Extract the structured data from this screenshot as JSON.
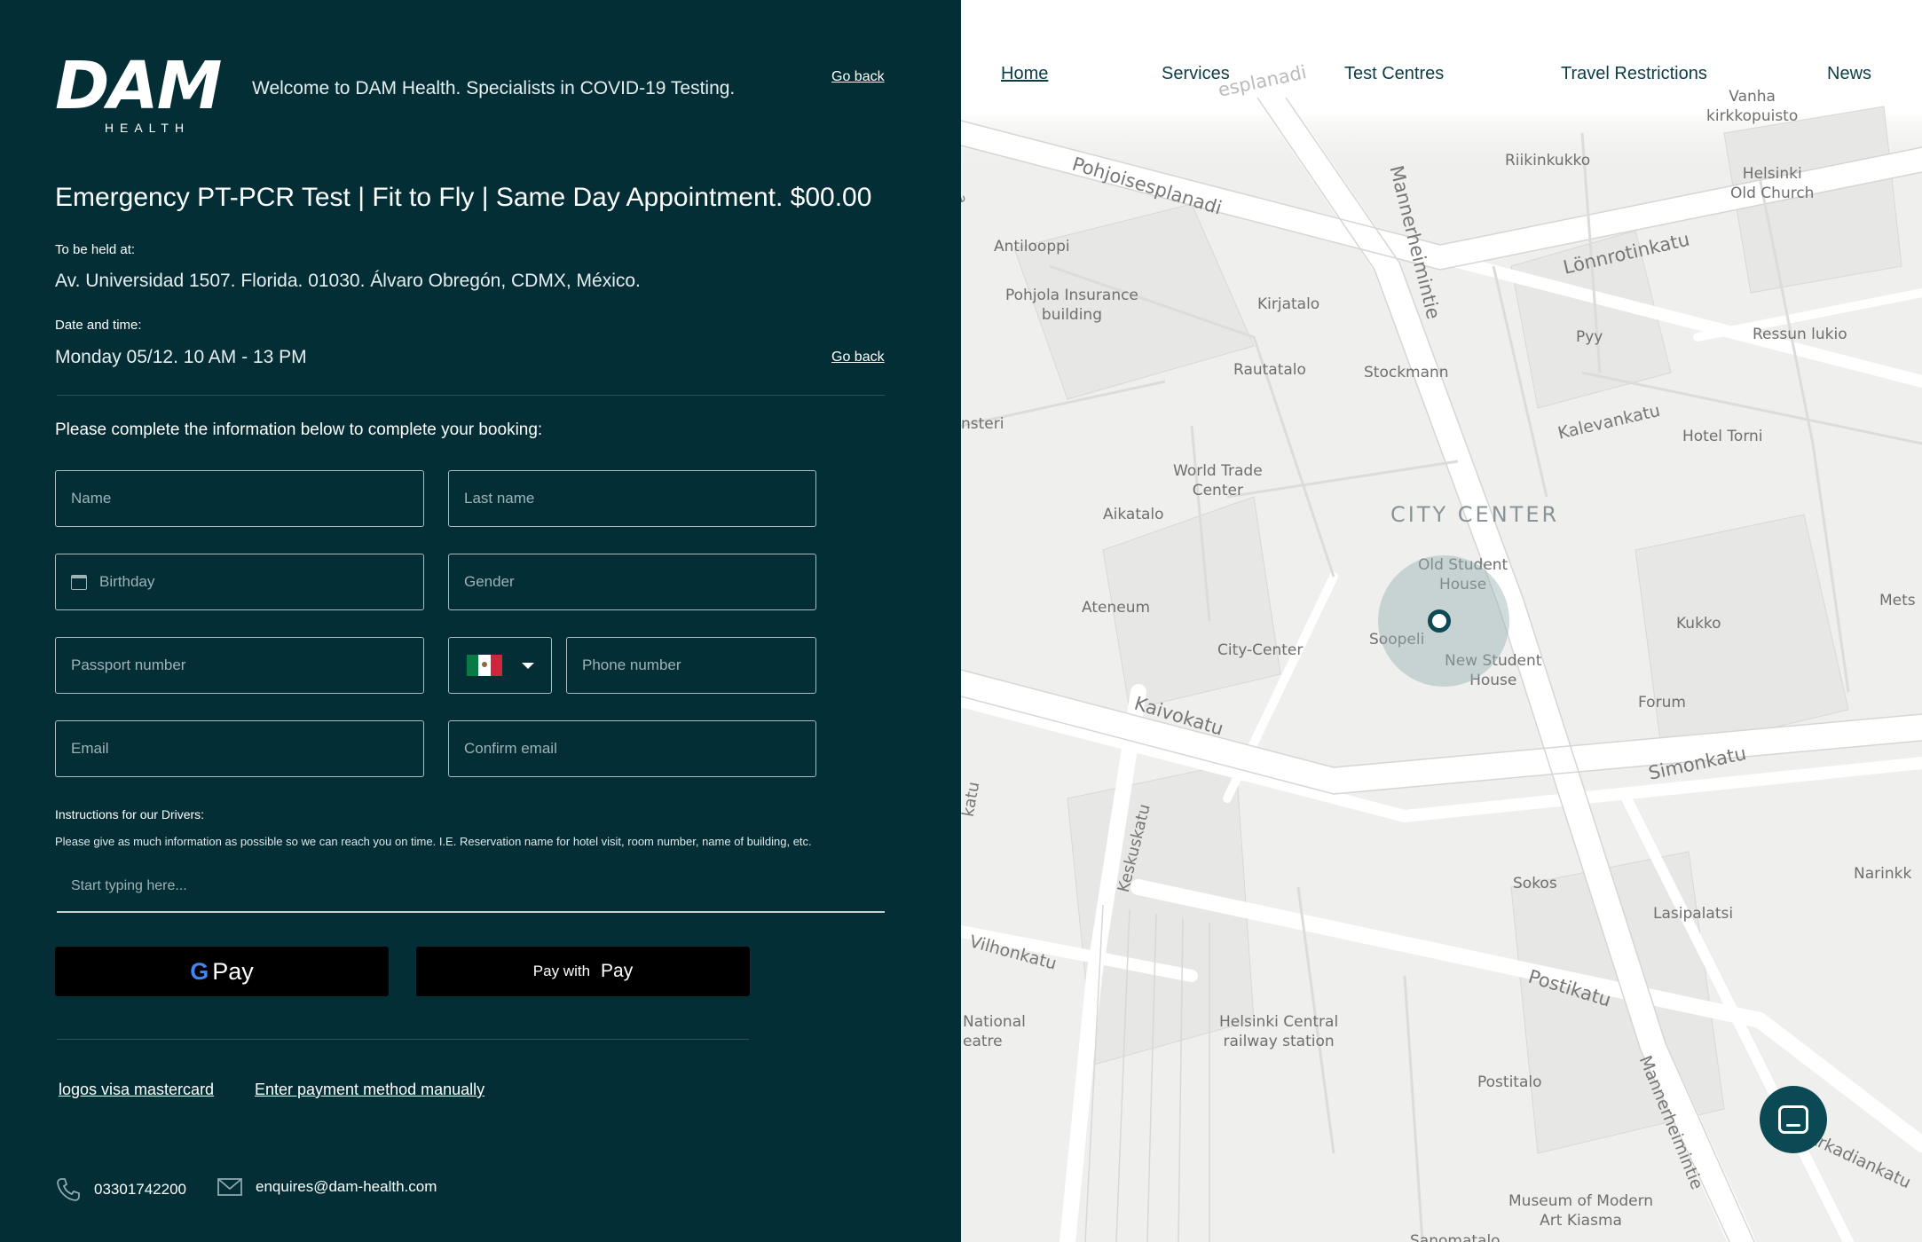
{
  "brand": {
    "logo_main": "DAM",
    "logo_sub": "HEALTH"
  },
  "header": {
    "welcome": "Welcome to DAM Health. Specialists in COVID-19 Testing.",
    "go_back": "Go back"
  },
  "booking": {
    "title": "Emergency PT-PCR Test | Fit to Fly | Same Day Appointment. $00.00",
    "location_label": "To be held at:",
    "location": "Av. Universidad 1507. Florida. 01030. Álvaro Obregón, CDMX, México.",
    "datetime_label": "Date and time:",
    "datetime": "Monday 05/12. 10 AM - 13 PM",
    "go_back": "Go back",
    "prompt": "Please complete the information below to complete your booking:"
  },
  "form": {
    "name": "Name",
    "last_name": "Last name",
    "birthday": "Birthday",
    "gender": "Gender",
    "passport": "Passport number",
    "phone": "Phone number",
    "email": "Email",
    "confirm_email": "Confirm email",
    "country_flag": "mexico-flag"
  },
  "instructions": {
    "title": "Instructions for our Drivers:",
    "text": "Please give as much information as possible so we can reach you on time. I.E. Reservation name for hotel visit, room number, name of building, etc.",
    "placeholder": "Start typing here..."
  },
  "payment": {
    "gpay_g": "G",
    "gpay_label": "Pay",
    "apple_prefix": "Pay with",
    "apple_logo": "",
    "apple_label": "Pay",
    "link_logos": "logos visa mastercard",
    "link_manual": "Enter payment method manually"
  },
  "contact": {
    "phone": "03301742200",
    "email": "enquires@dam-health.com"
  },
  "nav": {
    "home": "Home",
    "services": "Services",
    "centres": "Test Centres",
    "travel": "Travel Restrictions",
    "news": "News"
  },
  "map": {
    "city_center": "CITY CENTER",
    "places": {
      "vanha": "Vanha\nkirkkopuisto",
      "riikinkukko": "Riikinkukko",
      "helsinki_church": "Helsinki\nOld Church",
      "antilooppi": "Antilooppi",
      "pohjola": "Pohjola Insurance\nbuilding",
      "kirjatalo": "Kirjatalo",
      "pyy": "Pyy",
      "ressun": "Ressun lukio",
      "rautatalo": "Rautatalo",
      "stockmann": "Stockmann",
      "hotel_torni": "Hotel Torni",
      "world_trade": "World Trade\nCenter",
      "aikatalo": "Aikatalo",
      "old_student": "Old Student\nHouse",
      "ateneum": "Ateneum",
      "soopeli": "Soopeli",
      "city_center_mall": "City-Center",
      "new_student": "New Student\nHouse",
      "kukko": "Kukko",
      "forum": "Forum",
      "sokos": "Sokos",
      "lasipalatsi": "Lasipalatsi",
      "narinkka": "Narinkk",
      "metso": "Mets",
      "national": "National\neatre",
      "railway": "Helsinki Central\nrailway station",
      "postitalo": "Postitalo",
      "kiasma": "Museum of Modern\nArt Kiasma",
      "nsteri": "nsteri",
      "sanomatalo": "Sanomatalo"
    },
    "streets": {
      "pohjoisesplanadi": "Pohjoisesplanadi",
      "esplanadi": "esplanadi",
      "mannerheimintie": "Mannerheimintie",
      "lonnrotinkatu": "Lönnrotinkatu",
      "kalevankatu": "Kalevankatu",
      "kaivokatu": "Kaivokatu",
      "simonkatu": "Simonkatu",
      "keskuskatu": "Keskuskatu",
      "vilhonkatu": "Vilhonkatu",
      "postikatu": "Postikatu",
      "mannerheimintie2": "Mannerheimintie",
      "arkadiankatu": "Arkadiankatu",
      "katu": "katu",
      "esp_left": "a"
    }
  }
}
